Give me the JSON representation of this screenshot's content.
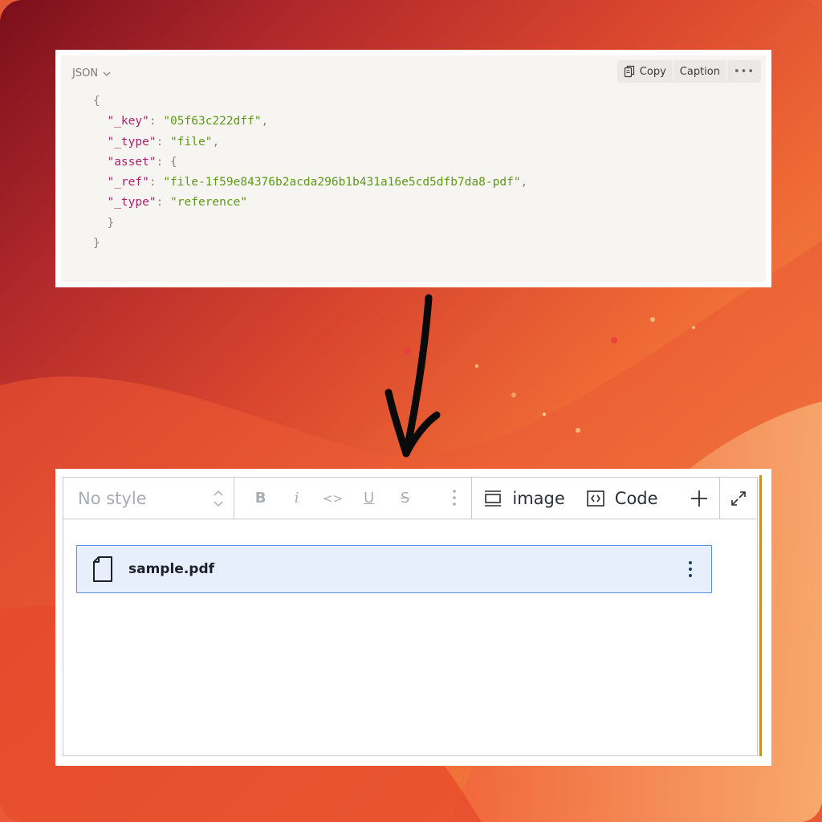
{
  "colors": {
    "json_key": "#b01f6a",
    "json_string": "#5d9a12",
    "selection_bg": "#e7effc",
    "selection_border": "#5a8ee6",
    "accent_bar": "#b8962c"
  },
  "json_panel": {
    "language_label": "JSON",
    "actions": {
      "copy": "Copy",
      "caption": "Caption",
      "more": "•••"
    },
    "code": {
      "open_brace": "{",
      "key_label": "\"_key\"",
      "key_value": "\"05f63c222dff\"",
      "type_label": "\"_type\"",
      "type_value": "\"file\"",
      "asset_label": "\"asset\"",
      "asset_open": "{",
      "ref_label": "\"_ref\"",
      "ref_value": "\"file-1f59e84376b2acda296b1b431a16e5cd5dfb7da8-pdf\"",
      "asset_type_label": "\"_type\"",
      "asset_type_value": "\"reference\"",
      "asset_close": "}",
      "close_brace": "}"
    }
  },
  "editor": {
    "style_select": "No style",
    "format_buttons": {
      "bold": "B",
      "italic": "i",
      "code": "<>",
      "underline": "U",
      "strike": "S"
    },
    "insert_items": [
      {
        "label": "image",
        "icon": "image-block-icon"
      },
      {
        "label": "Code",
        "icon": "code-block-icon"
      }
    ],
    "file_block": {
      "filename": "sample.pdf",
      "icon": "document-icon"
    }
  }
}
